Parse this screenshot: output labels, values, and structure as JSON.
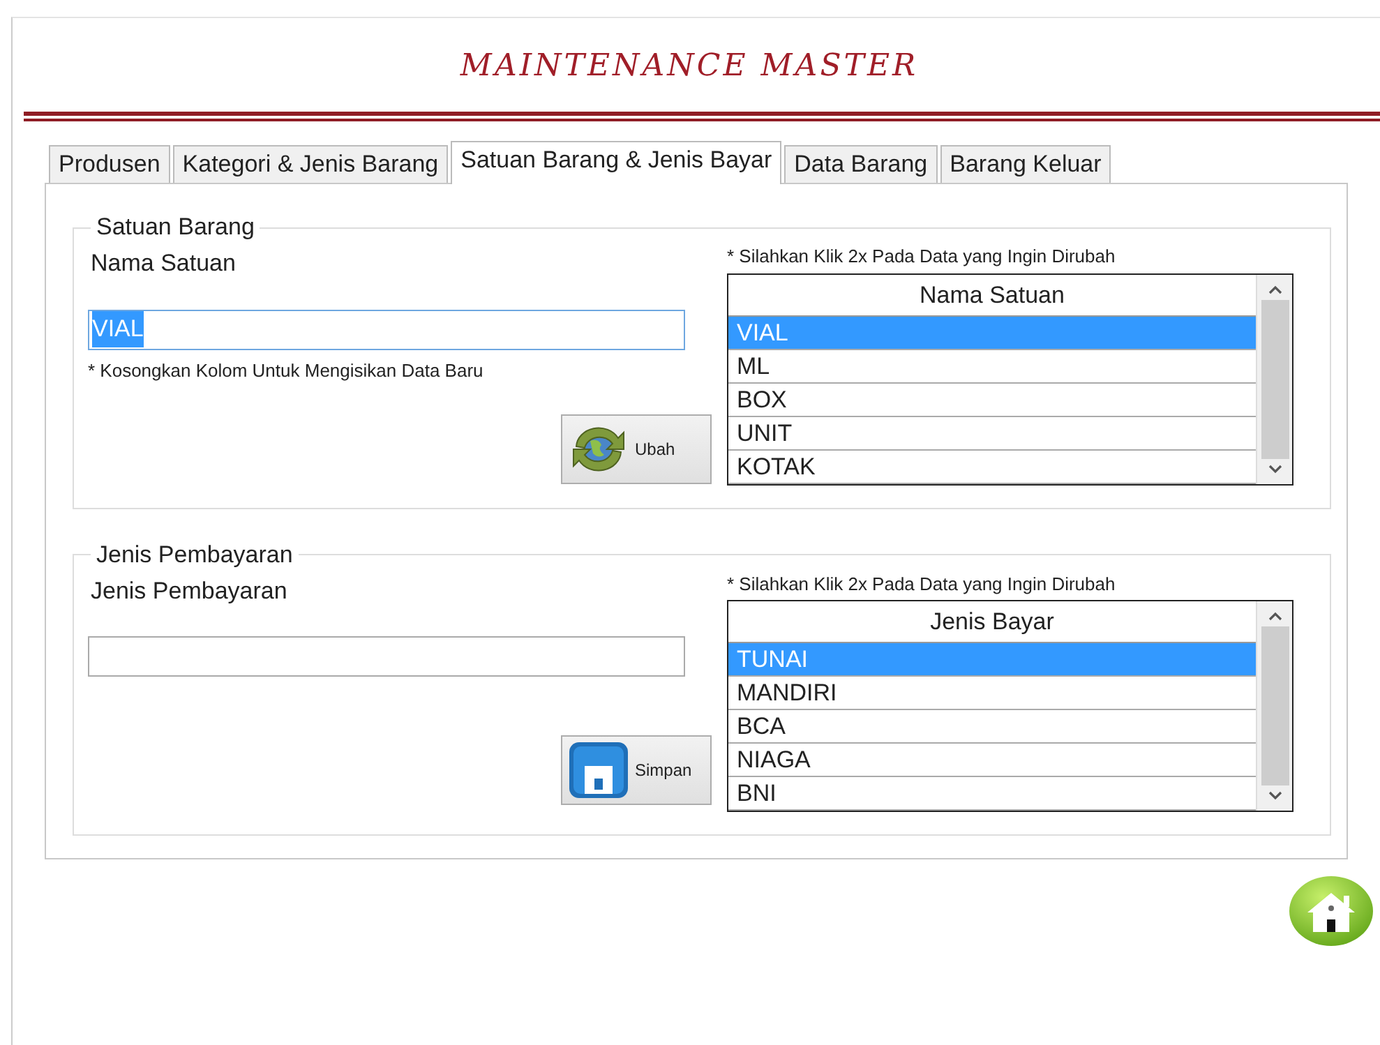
{
  "window": {
    "title": "MAINTENANCE MASTER"
  },
  "tabs": [
    {
      "label": "Produsen",
      "selected": false
    },
    {
      "label": "Kategori & Jenis Barang",
      "selected": false
    },
    {
      "label": "Satuan Barang & Jenis Bayar",
      "selected": true
    },
    {
      "label": "Data Barang",
      "selected": false
    },
    {
      "label": "Barang Keluar",
      "selected": false
    }
  ],
  "sections": [
    {
      "legend": "Satuan Barang",
      "field_label": "Nama Satuan",
      "field": {
        "value": "VIAL",
        "text_selected": true
      },
      "hint": "* Kosongkan Kolom Untuk Mengisikan Data Baru",
      "button": {
        "label": "Ubah",
        "kind": "update"
      },
      "list_note": "* Silahkan Klik 2x Pada Data yang Ingin Dirubah",
      "list": {
        "header": "Nama Satuan",
        "rows": [
          {
            "text": "VIAL",
            "selected": true
          },
          {
            "text": "ML",
            "selected": false
          },
          {
            "text": "BOX",
            "selected": false
          },
          {
            "text": "UNIT",
            "selected": false
          },
          {
            "text": "KOTAK",
            "selected": false
          }
        ]
      }
    },
    {
      "legend": "Jenis Pembayaran",
      "field_label": "Jenis Pembayaran",
      "field": {
        "text_selected": false
      },
      "button": {
        "label": "Simpan",
        "kind": "save"
      },
      "list_note": "* Silahkan Klik 2x Pada Data yang Ingin Dirubah",
      "list": {
        "header": "Jenis Bayar",
        "rows": [
          {
            "text": "TUNAI",
            "selected": true
          },
          {
            "text": "MANDIRI",
            "selected": false
          },
          {
            "text": "BCA",
            "selected": false
          },
          {
            "text": "NIAGA",
            "selected": false
          },
          {
            "text": "BNI",
            "selected": false
          }
        ]
      }
    }
  ]
}
